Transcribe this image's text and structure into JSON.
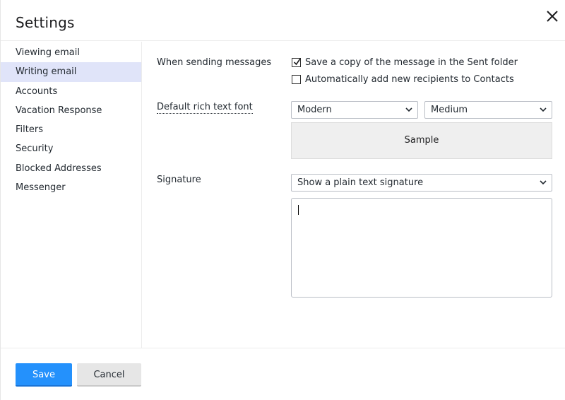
{
  "dialog": {
    "title": "Settings",
    "close_icon": "close-icon"
  },
  "sidebar": {
    "items": [
      {
        "label": "Viewing email",
        "active": false
      },
      {
        "label": "Writing email",
        "active": true
      },
      {
        "label": "Accounts",
        "active": false
      },
      {
        "label": "Vacation Response",
        "active": false
      },
      {
        "label": "Filters",
        "active": false
      },
      {
        "label": "Security",
        "active": false
      },
      {
        "label": "Blocked Addresses",
        "active": false
      },
      {
        "label": "Messenger",
        "active": false
      }
    ]
  },
  "sending": {
    "label": "When sending messages",
    "save_copy": {
      "label": "Save a copy of the message in the Sent folder",
      "checked": true
    },
    "add_contacts": {
      "label": "Automatically add new recipients to Contacts",
      "checked": false
    }
  },
  "font": {
    "label": "Default rich text font",
    "family_value": "Modern",
    "size_value": "Medium",
    "sample_text": "Sample"
  },
  "signature": {
    "label": "Signature",
    "mode_value": "Show a plain text signature",
    "text": ""
  },
  "footer": {
    "save_label": "Save",
    "cancel_label": "Cancel"
  },
  "colors": {
    "accent": "#2491fc",
    "active_nav": "#e0e4f9"
  }
}
